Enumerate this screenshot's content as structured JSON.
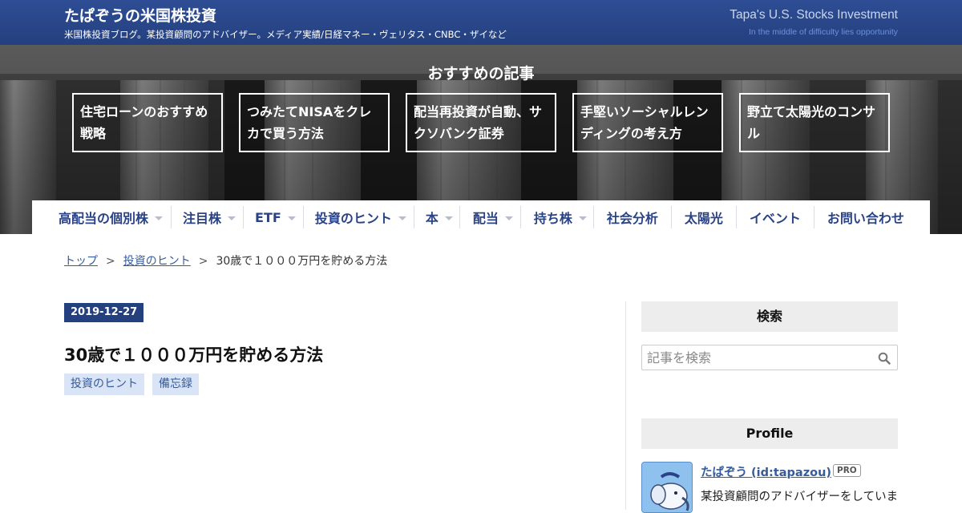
{
  "header": {
    "site_title": "たぱぞうの米国株投資",
    "description": "米国株投資ブログ。某投資顧問のアドバイザー。メディア実績/日経マネー・ヴェリタス・CNBC・ザイなど",
    "english_title": "Tapa's U.S. Stocks Investment",
    "tagline": "In the middle of difficulty lies opportunity",
    "colors": {
      "bar": "#24407f",
      "accent": "#355b9c"
    }
  },
  "recommended": {
    "heading": "おすすめの記事",
    "items": [
      {
        "label": "住宅ローンのおすすめ戦略"
      },
      {
        "label": "つみたてNISAをクレカで買う方法"
      },
      {
        "label": "配当再投資が自動、サクソバンク証券"
      },
      {
        "label": "手堅いソーシャルレンディングの考え方"
      },
      {
        "label": "野立て太陽光のコンサル"
      }
    ]
  },
  "nav": {
    "items": [
      {
        "label": "高配当の個別株",
        "dropdown": true
      },
      {
        "label": "注目株",
        "dropdown": true
      },
      {
        "label": "ETF",
        "dropdown": true
      },
      {
        "label": "投資のヒント",
        "dropdown": true
      },
      {
        "label": "本",
        "dropdown": true
      },
      {
        "label": "配当",
        "dropdown": true
      },
      {
        "label": "持ち株",
        "dropdown": true
      },
      {
        "label": "社会分析",
        "dropdown": false
      },
      {
        "label": "太陽光",
        "dropdown": false
      },
      {
        "label": "イベント",
        "dropdown": false
      },
      {
        "label": "お問い合わせ",
        "dropdown": false
      }
    ]
  },
  "breadcrumb": {
    "top": "トップ",
    "separator": ">",
    "category": "投資のヒント",
    "current": "30歳で１０００万円を貯める方法"
  },
  "article": {
    "date": "2019-12-27",
    "title": "30歳で１０００万円を貯める方法",
    "categories": [
      "投資のヒント",
      "備忘録"
    ]
  },
  "sidebar": {
    "search_heading": "検索",
    "search_placeholder": "記事を検索",
    "profile_heading": "Profile",
    "profile_name": "たぱぞう (id:tapazou)",
    "pro_badge": "PRO",
    "profile_text": "某投資顧問のアドバイザーをしていま"
  }
}
